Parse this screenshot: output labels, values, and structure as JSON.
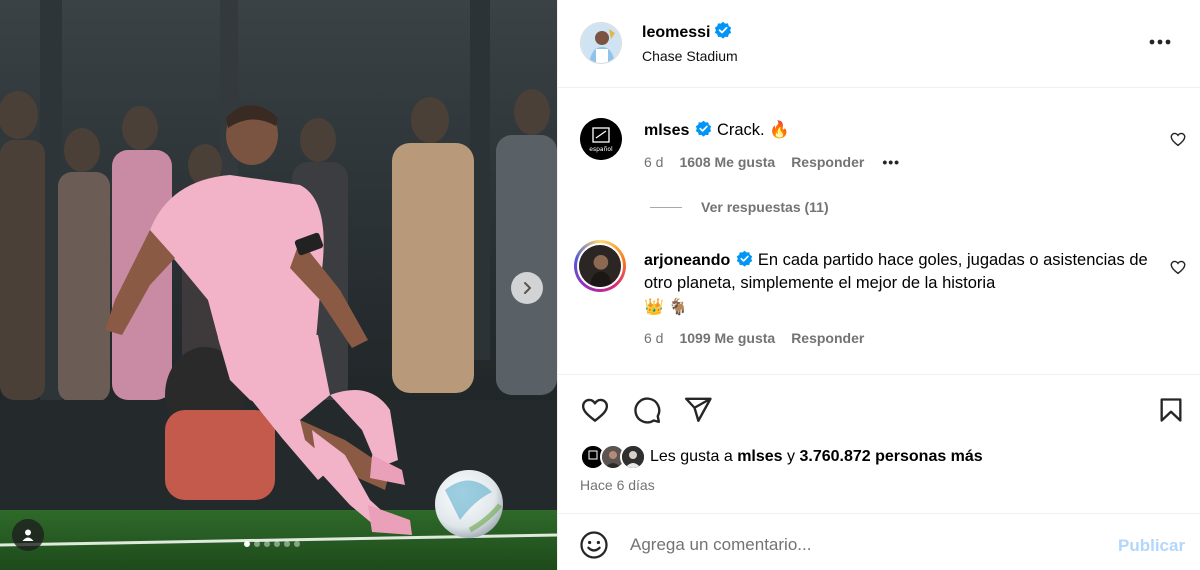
{
  "post": {
    "author": "leomessi",
    "author_verified": true,
    "location": "Chase Stadium",
    "options_icon": "more-horizontal-icon"
  },
  "carousel": {
    "total_slides": 6,
    "active_slide": 1,
    "next_icon": "chevron-right-icon",
    "tagged_icon": "user-tag-icon"
  },
  "comments": [
    {
      "username": "mlses",
      "verified": true,
      "text": "Crack. 🔥",
      "age": "6 d",
      "likes": "1608 Me gusta",
      "reply_label": "Responder",
      "more_label": "•••",
      "replies_label": "Ver respuestas (11)"
    },
    {
      "username": "arjoneando",
      "verified": true,
      "text": "En cada partido hace goles, jugadas o asistencias de otro planeta, simplemente el mejor de la historia",
      "emoji": "👑 🐐",
      "age": "6 d",
      "likes": "1099 Me gusta",
      "reply_label": "Responder"
    }
  ],
  "actions": {
    "like_icon": "heart-icon",
    "comment_icon": "comment-icon",
    "share_icon": "paper-plane-icon",
    "save_icon": "bookmark-icon"
  },
  "likes_summary": {
    "prefix": "Les gusta a",
    "first_user": "mlses",
    "connector": "y",
    "others": "3.760.872 personas más"
  },
  "posted": "Hace 6 días",
  "composer": {
    "placeholder": "Agrega un comentario...",
    "post_label": "Publicar",
    "emoji_icon": "smiley-icon"
  },
  "colors": {
    "verified_blue": "#0095f6",
    "muted_text": "#737373",
    "post_button_disabled": "#b2d7fb",
    "kit_pink": "#f2b3c8"
  }
}
